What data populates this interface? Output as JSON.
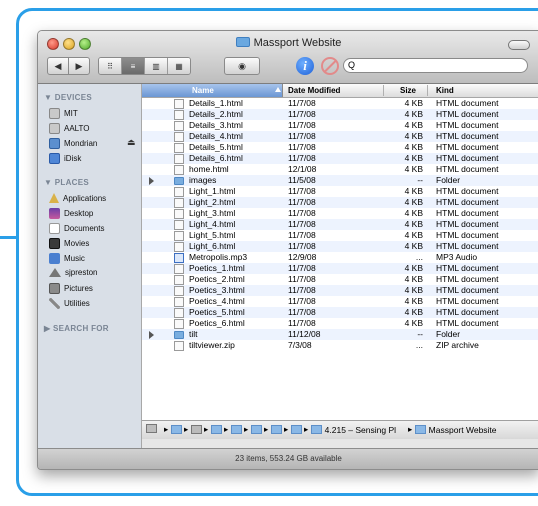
{
  "window": {
    "title": "Massport Website",
    "status": "23 items, 553.24 GB available"
  },
  "toolbar": {
    "back": "◀",
    "forward": "▶",
    "views": [
      "⠿",
      "≡",
      "▥",
      "▦"
    ],
    "eye": "◉",
    "info": "i",
    "search_placeholder": "Q"
  },
  "sidebar": {
    "devices_header": "▼ DEVICES",
    "devices": [
      "MIT",
      "AALTO",
      "Mondrian",
      "iDisk"
    ],
    "eject": "⏏",
    "places_header": "▼ PLACES",
    "places": [
      "Applications",
      "Desktop",
      "Documents",
      "Movies",
      "Music",
      "sjpreston",
      "Pictures",
      "Utilities"
    ],
    "search_header": "▶ SEARCH FOR"
  },
  "columns": {
    "name": "Name",
    "date": "Date Modified",
    "size": "Size",
    "kind": "Kind"
  },
  "files": [
    {
      "name": "Details_1.html",
      "date": "11/7/08",
      "size": "4 KB",
      "kind": "HTML document",
      "type": "doc"
    },
    {
      "name": "Details_2.html",
      "date": "11/7/08",
      "size": "4 KB",
      "kind": "HTML document",
      "type": "doc"
    },
    {
      "name": "Details_3.html",
      "date": "11/7/08",
      "size": "4 KB",
      "kind": "HTML document",
      "type": "doc"
    },
    {
      "name": "Details_4.html",
      "date": "11/7/08",
      "size": "4 KB",
      "kind": "HTML document",
      "type": "doc"
    },
    {
      "name": "Details_5.html",
      "date": "11/7/08",
      "size": "4 KB",
      "kind": "HTML document",
      "type": "doc"
    },
    {
      "name": "Details_6.html",
      "date": "11/7/08",
      "size": "4 KB",
      "kind": "HTML document",
      "type": "doc"
    },
    {
      "name": "home.html",
      "date": "12/1/08",
      "size": "4 KB",
      "kind": "HTML document",
      "type": "doc"
    },
    {
      "name": "images",
      "date": "11/5/08",
      "size": "--",
      "kind": "Folder",
      "type": "folder"
    },
    {
      "name": "Light_1.html",
      "date": "11/7/08",
      "size": "4 KB",
      "kind": "HTML document",
      "type": "doc"
    },
    {
      "name": "Light_2.html",
      "date": "11/7/08",
      "size": "4 KB",
      "kind": "HTML document",
      "type": "doc"
    },
    {
      "name": "Light_3.html",
      "date": "11/7/08",
      "size": "4 KB",
      "kind": "HTML document",
      "type": "doc"
    },
    {
      "name": "Light_4.html",
      "date": "11/7/08",
      "size": "4 KB",
      "kind": "HTML document",
      "type": "doc"
    },
    {
      "name": "Light_5.html",
      "date": "11/7/08",
      "size": "4 KB",
      "kind": "HTML document",
      "type": "doc"
    },
    {
      "name": "Light_6.html",
      "date": "11/7/08",
      "size": "4 KB",
      "kind": "HTML document",
      "type": "doc"
    },
    {
      "name": "Metropolis.mp3",
      "date": "12/9/08",
      "size": "...",
      "kind": "MP3 Audio",
      "type": "audio"
    },
    {
      "name": "Poetics_1.html",
      "date": "11/7/08",
      "size": "4 KB",
      "kind": "HTML document",
      "type": "doc"
    },
    {
      "name": "Poetics_2.html",
      "date": "11/7/08",
      "size": "4 KB",
      "kind": "HTML document",
      "type": "doc"
    },
    {
      "name": "Poetics_3.html",
      "date": "11/7/08",
      "size": "4 KB",
      "kind": "HTML document",
      "type": "doc"
    },
    {
      "name": "Poetics_4.html",
      "date": "11/7/08",
      "size": "4 KB",
      "kind": "HTML document",
      "type": "doc"
    },
    {
      "name": "Poetics_5.html",
      "date": "11/7/08",
      "size": "4 KB",
      "kind": "HTML document",
      "type": "doc"
    },
    {
      "name": "Poetics_6.html",
      "date": "11/7/08",
      "size": "4 KB",
      "kind": "HTML document",
      "type": "doc"
    },
    {
      "name": "tilt",
      "date": "11/12/08",
      "size": "--",
      "kind": "Folder",
      "type": "folder"
    },
    {
      "name": "tiltviewer.zip",
      "date": "7/3/08",
      "size": "...",
      "kind": "ZIP archive",
      "type": "doc"
    }
  ],
  "pathbar": {
    "segments": [
      "4.215 – Sensing Pl",
      "Massport Website"
    ],
    "arrow": "▸"
  },
  "colors": {
    "frame": "#2a9fe8",
    "selection_header": "#6b96d3",
    "alt_row": "#edf3fe"
  }
}
